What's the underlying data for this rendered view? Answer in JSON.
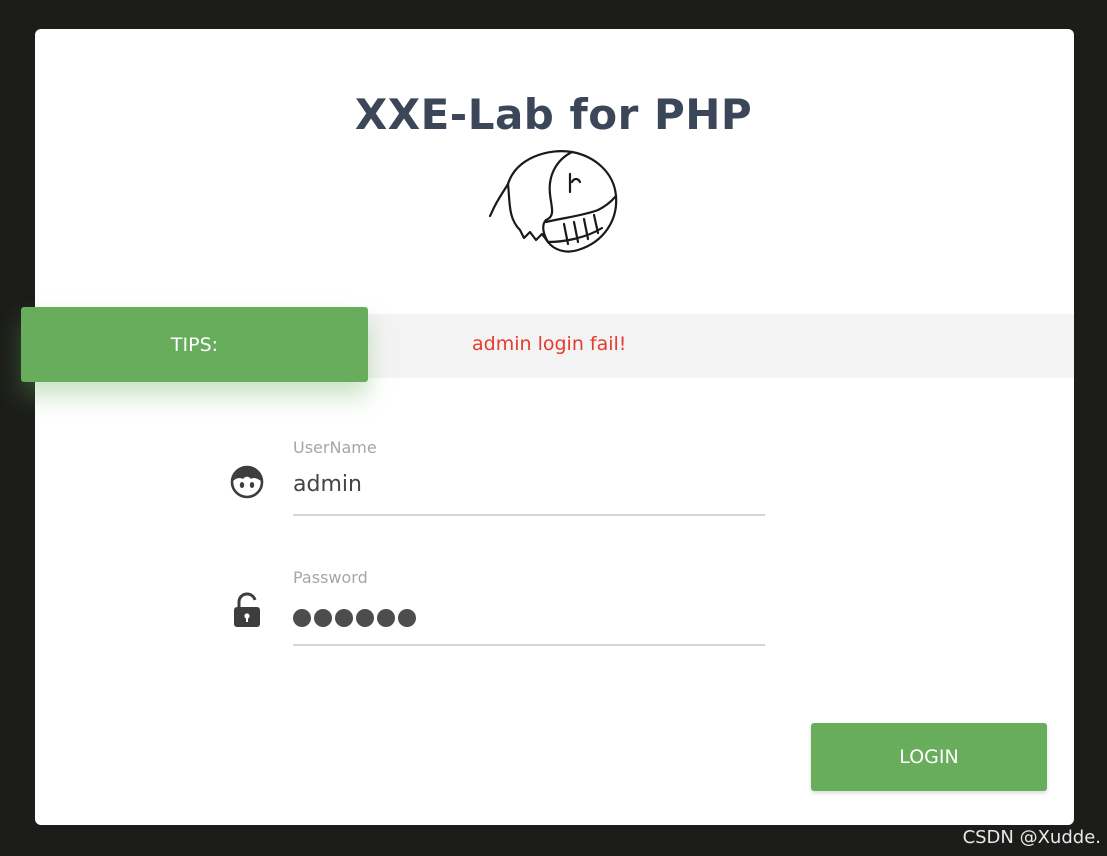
{
  "header": {
    "title": "XXE-Lab for PHP",
    "logo_icon": "elephant-icon"
  },
  "tips": {
    "label": "TIPS:",
    "message": "admin login fail!",
    "label_color": "#68ad5c",
    "message_color": "#e53b30"
  },
  "form": {
    "username": {
      "label": "UserName",
      "value": "admin",
      "icon": "user-face-icon"
    },
    "password": {
      "label": "Password",
      "masked_length": 6,
      "icon": "unlocked-padlock-icon"
    },
    "login_label": "LOGIN"
  },
  "colors": {
    "accent": "#68ad5c",
    "title": "#3b4659",
    "error": "#e53b30",
    "background": "#1c1d1a"
  },
  "watermark": "CSDN @Xudde."
}
